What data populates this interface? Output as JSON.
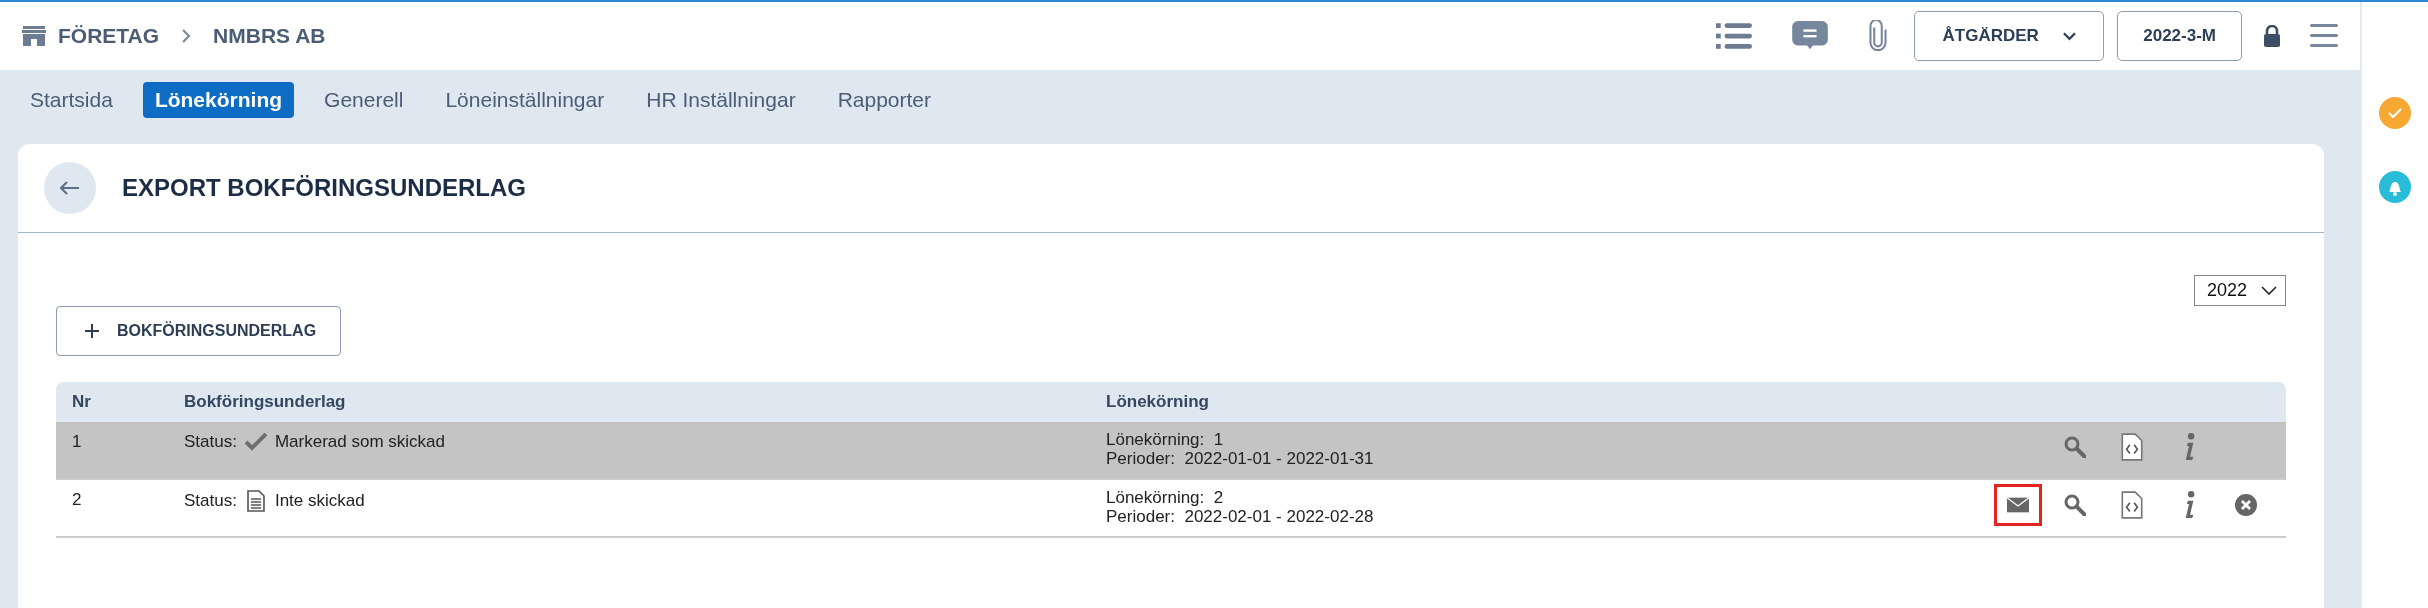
{
  "breadcrumb": {
    "company_label": "FÖRETAG",
    "company_name": "NMBRS AB"
  },
  "toolbar": {
    "actions_button": "ÅTGÄRDER",
    "period_button": "2022-3-M"
  },
  "tabs": [
    {
      "label": "Startsida",
      "selected": false
    },
    {
      "label": "Lönekörning",
      "selected": true
    },
    {
      "label": "Generell",
      "selected": false
    },
    {
      "label": "Löneinställningar",
      "selected": false
    },
    {
      "label": "HR Inställningar",
      "selected": false
    },
    {
      "label": "Rapporter",
      "selected": false
    }
  ],
  "page": {
    "title": "EXPORT BOKFÖRINGSUNDERLAG",
    "year_select": "2022",
    "add_button": "BOKFÖRINGSUNDERLAG"
  },
  "table": {
    "columns": [
      "Nr",
      "Bokföringsunderlag",
      "Lönekörning"
    ],
    "rows": [
      {
        "nr": "1",
        "status_label": "Status:",
        "status": {
          "kind": "sent",
          "text": "Markerad som skickad"
        },
        "payrun_label": "Lönekörning:",
        "payrun": "1",
        "period_label": "Perioder:",
        "period": "2022-01-01 - 2022-01-31",
        "selected": true,
        "actions": [
          {
            "kind": "view",
            "highlighted": false
          },
          {
            "kind": "xml",
            "highlighted": false
          },
          {
            "kind": "info",
            "highlighted": false
          }
        ]
      },
      {
        "nr": "2",
        "status_label": "Status:",
        "status": {
          "kind": "not_sent",
          "text": "Inte skickad"
        },
        "payrun_label": "Lönekörning:",
        "payrun": "2",
        "period_label": "Perioder:",
        "period": "2022-02-01 - 2022-02-28",
        "selected": false,
        "actions": [
          {
            "kind": "email",
            "highlighted": true
          },
          {
            "kind": "view",
            "highlighted": false
          },
          {
            "kind": "xml",
            "highlighted": false
          },
          {
            "kind": "info",
            "highlighted": false
          },
          {
            "kind": "delete",
            "highlighted": false
          }
        ]
      }
    ]
  }
}
